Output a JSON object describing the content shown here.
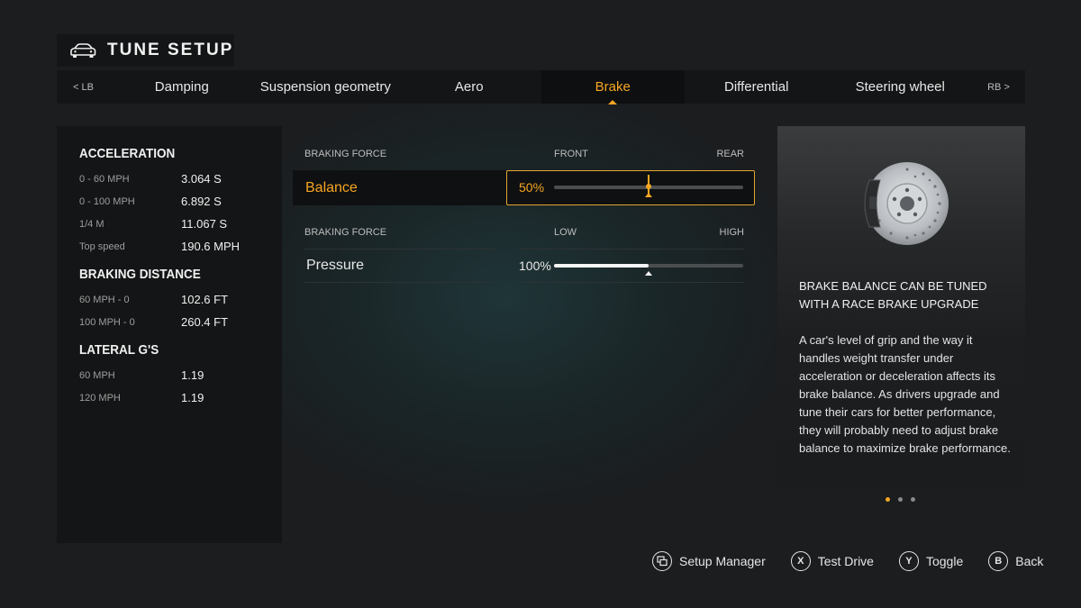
{
  "header": {
    "title": "TUNE SETUP"
  },
  "tabs": {
    "prev": "< LB",
    "next": "RB >",
    "items": [
      {
        "label": "Damping"
      },
      {
        "label": "Suspension geometry"
      },
      {
        "label": "Aero"
      },
      {
        "label": "Brake"
      },
      {
        "label": "Differential"
      },
      {
        "label": "Steering wheel"
      }
    ],
    "active": "Brake"
  },
  "stats": {
    "acceleration": {
      "title": "ACCELERATION",
      "rows": [
        {
          "label": "0 - 60 MPH",
          "value": "3.064 S"
        },
        {
          "label": "0 - 100 MPH",
          "value": "6.892 S"
        },
        {
          "label": "1/4 M",
          "value": "11.067 S"
        },
        {
          "label": "Top speed",
          "value": "190.6 MPH"
        }
      ]
    },
    "braking": {
      "title": "BRAKING DISTANCE",
      "rows": [
        {
          "label": "60 MPH - 0",
          "value": "102.6 FT"
        },
        {
          "label": "100 MPH - 0",
          "value": "260.4 FT"
        }
      ]
    },
    "lateral": {
      "title": "LATERAL G'S",
      "rows": [
        {
          "label": "60 MPH",
          "value": "1.19"
        },
        {
          "label": "120 MPH",
          "value": "1.19"
        }
      ]
    }
  },
  "settings": {
    "balance": {
      "header_left": "BRAKING FORCE",
      "header_mid": "FRONT",
      "header_right": "REAR",
      "label": "Balance",
      "value_text": "50%",
      "value": 0.5
    },
    "pressure": {
      "header_left": "BRAKING FORCE",
      "header_mid": "LOW",
      "header_right": "HIGH",
      "label": "Pressure",
      "value_text": "100%",
      "value": 0.5
    }
  },
  "info": {
    "title": "BRAKE BALANCE CAN BE TUNED WITH A RACE BRAKE UPGRADE",
    "body": "A car's level of grip and the way it handles weight transfer under acceleration or deceleration affects its brake balance. As drivers upgrade and tune their cars for better performance, they will probably need to adjust brake balance to maximize brake performance.",
    "page_count": 3,
    "page_index": 0
  },
  "footer": {
    "buttons": [
      {
        "key": "",
        "label": "Setup Manager",
        "icon": "setup-manager-icon"
      },
      {
        "key": "X",
        "label": "Test Drive"
      },
      {
        "key": "Y",
        "label": "Toggle"
      },
      {
        "key": "B",
        "label": "Back"
      }
    ]
  },
  "colors": {
    "accent": "#f5a623",
    "panel": "#141516"
  }
}
